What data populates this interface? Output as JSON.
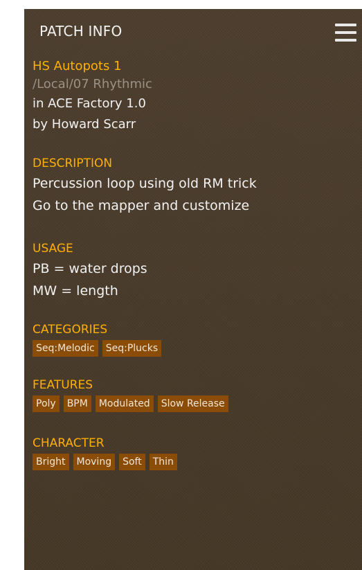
{
  "header": {
    "title": "PATCH INFO",
    "menu_icon": "hamburger-menu-icon"
  },
  "patch": {
    "name": "HS Autopots 1",
    "path": "/Local/07 Rhythmic",
    "bank": "in ACE Factory 1.0",
    "author": "by Howard Scarr"
  },
  "description": {
    "heading": "DESCRIPTION",
    "lines": [
      "Percussion loop using old RM trick",
      "Go to the mapper and customize"
    ]
  },
  "usage": {
    "heading": "USAGE",
    "lines": [
      "PB = water drops",
      "MW = length"
    ]
  },
  "categories": {
    "heading": "CATEGORIES",
    "tags": [
      "Seq:Melodic",
      "Seq:Plucks"
    ]
  },
  "features": {
    "heading": "FEATURES",
    "tags": [
      "Poly",
      "BPM",
      "Modulated",
      "Slow Release"
    ]
  },
  "character": {
    "heading": "CHARACTER",
    "tags": [
      "Bright",
      "Moving",
      "Soft",
      "Thin"
    ]
  },
  "colors": {
    "panel_background": "#4a3c2c",
    "accent": "#ffb000",
    "tag_background": "#8a4c06",
    "text": "#f2f2f2",
    "path_text": "#9a9286"
  }
}
